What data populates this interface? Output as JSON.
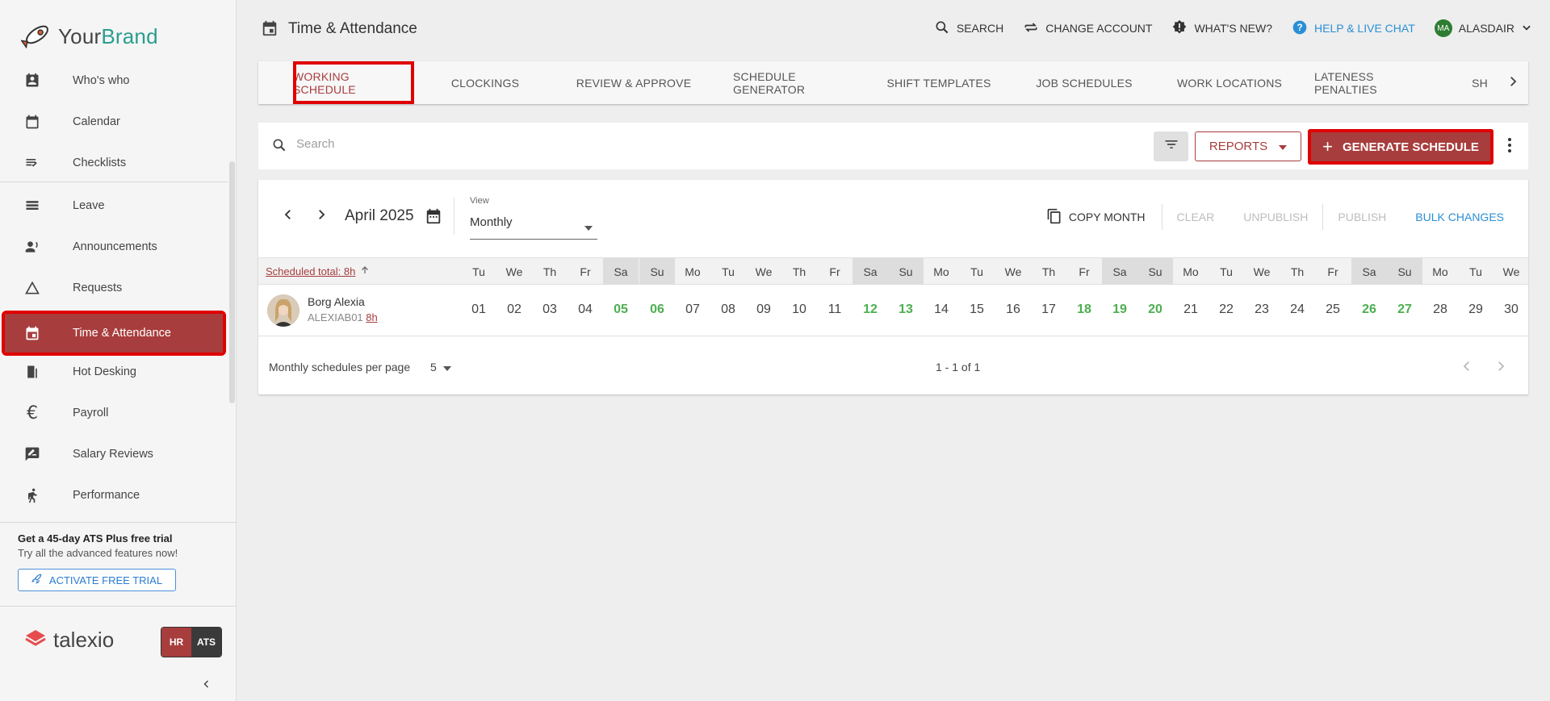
{
  "sidebar": {
    "brand": {
      "part1": "Your",
      "part2": "Brand"
    },
    "items": [
      {
        "label": "Who's who",
        "icon": "contact-icon"
      },
      {
        "label": "Calendar",
        "icon": "calendar-icon"
      },
      {
        "label": "Checklists",
        "icon": "checklist-icon"
      },
      {
        "label": "Leave",
        "icon": "leave-icon"
      },
      {
        "label": "Announcements",
        "icon": "megaphone-icon"
      },
      {
        "label": "Requests",
        "icon": "triangle-icon"
      },
      {
        "label": "Time & Attendance",
        "icon": "calendar-today-icon"
      },
      {
        "label": "Hot Desking",
        "icon": "door-icon"
      },
      {
        "label": "Payroll",
        "icon": "euro-icon"
      },
      {
        "label": "Salary Reviews",
        "icon": "rate-review-icon"
      },
      {
        "label": "Performance",
        "icon": "run-icon"
      }
    ],
    "trial_title": "Get a 45-day ATS Plus free trial",
    "trial_sub": "Try all the advanced features now!",
    "trial_btn": "ACTIVATE FREE TRIAL",
    "product": "talexio",
    "badge_hr": "HR",
    "badge_ats": "ATS"
  },
  "header": {
    "title": "Time & Attendance",
    "search": "SEARCH",
    "change_account": "CHANGE ACCOUNT",
    "whats_new": "WHAT'S NEW?",
    "help": "HELP & LIVE CHAT",
    "avatar_initials": "MA",
    "user": "ALASDAIR"
  },
  "tabs": [
    "WORKING SCHEDULE",
    "CLOCKINGS",
    "REVIEW & APPROVE",
    "SCHEDULE GENERATOR",
    "SHIFT TEMPLATES",
    "JOB SCHEDULES",
    "WORK LOCATIONS",
    "LATENESS PENALTIES",
    "SH"
  ],
  "search": {
    "placeholder": "Search",
    "reports": "REPORTS",
    "generate": "GENERATE SCHEDULE"
  },
  "schedule": {
    "month": "April 2025",
    "view_label": "View",
    "view_value": "Monthly",
    "copy_month": "COPY MONTH",
    "clear": "CLEAR",
    "unpublish": "UNPUBLISH",
    "publish": "PUBLISH",
    "bulk_changes": "BULK CHANGES",
    "scheduled_total": "Scheduled total: 8h",
    "days": [
      {
        "d": "Tu",
        "n": "01",
        "we": false
      },
      {
        "d": "We",
        "n": "02",
        "we": false
      },
      {
        "d": "Th",
        "n": "03",
        "we": false
      },
      {
        "d": "Fr",
        "n": "04",
        "we": false
      },
      {
        "d": "Sa",
        "n": "05",
        "we": true
      },
      {
        "d": "Su",
        "n": "06",
        "we": true
      },
      {
        "d": "Mo",
        "n": "07",
        "we": false
      },
      {
        "d": "Tu",
        "n": "08",
        "we": false
      },
      {
        "d": "We",
        "n": "09",
        "we": false
      },
      {
        "d": "Th",
        "n": "10",
        "we": false
      },
      {
        "d": "Fr",
        "n": "11",
        "we": false
      },
      {
        "d": "Sa",
        "n": "12",
        "we": true
      },
      {
        "d": "Su",
        "n": "13",
        "we": true
      },
      {
        "d": "Mo",
        "n": "14",
        "we": false
      },
      {
        "d": "Tu",
        "n": "15",
        "we": false
      },
      {
        "d": "We",
        "n": "16",
        "we": false
      },
      {
        "d": "Th",
        "n": "17",
        "we": false
      },
      {
        "d": "Fr",
        "n": "18",
        "we": true
      },
      {
        "d": "Sa",
        "n": "19",
        "we": true
      },
      {
        "d": "Su",
        "n": "20",
        "we": true
      },
      {
        "d": "Mo",
        "n": "21",
        "we": false
      },
      {
        "d": "Tu",
        "n": "22",
        "we": false
      },
      {
        "d": "We",
        "n": "23",
        "we": false
      },
      {
        "d": "Th",
        "n": "24",
        "we": false
      },
      {
        "d": "Fr",
        "n": "25",
        "we": false
      },
      {
        "d": "Sa",
        "n": "26",
        "we": true
      },
      {
        "d": "Su",
        "n": "27",
        "we": true
      },
      {
        "d": "Mo",
        "n": "28",
        "we": false
      },
      {
        "d": "Tu",
        "n": "29",
        "we": false
      },
      {
        "d": "We",
        "n": "30",
        "we": false
      }
    ],
    "employee": {
      "name": "Borg Alexia",
      "code": "ALEXIAB01",
      "hours": "8h"
    },
    "per_page_label": "Monthly schedules per page",
    "per_page": "5",
    "range": "1 - 1 of 1"
  },
  "colors": {
    "accent": "#a83d3d",
    "weekend": "#4caf50",
    "link": "#2a8fd6",
    "highlight": "#e00000"
  }
}
